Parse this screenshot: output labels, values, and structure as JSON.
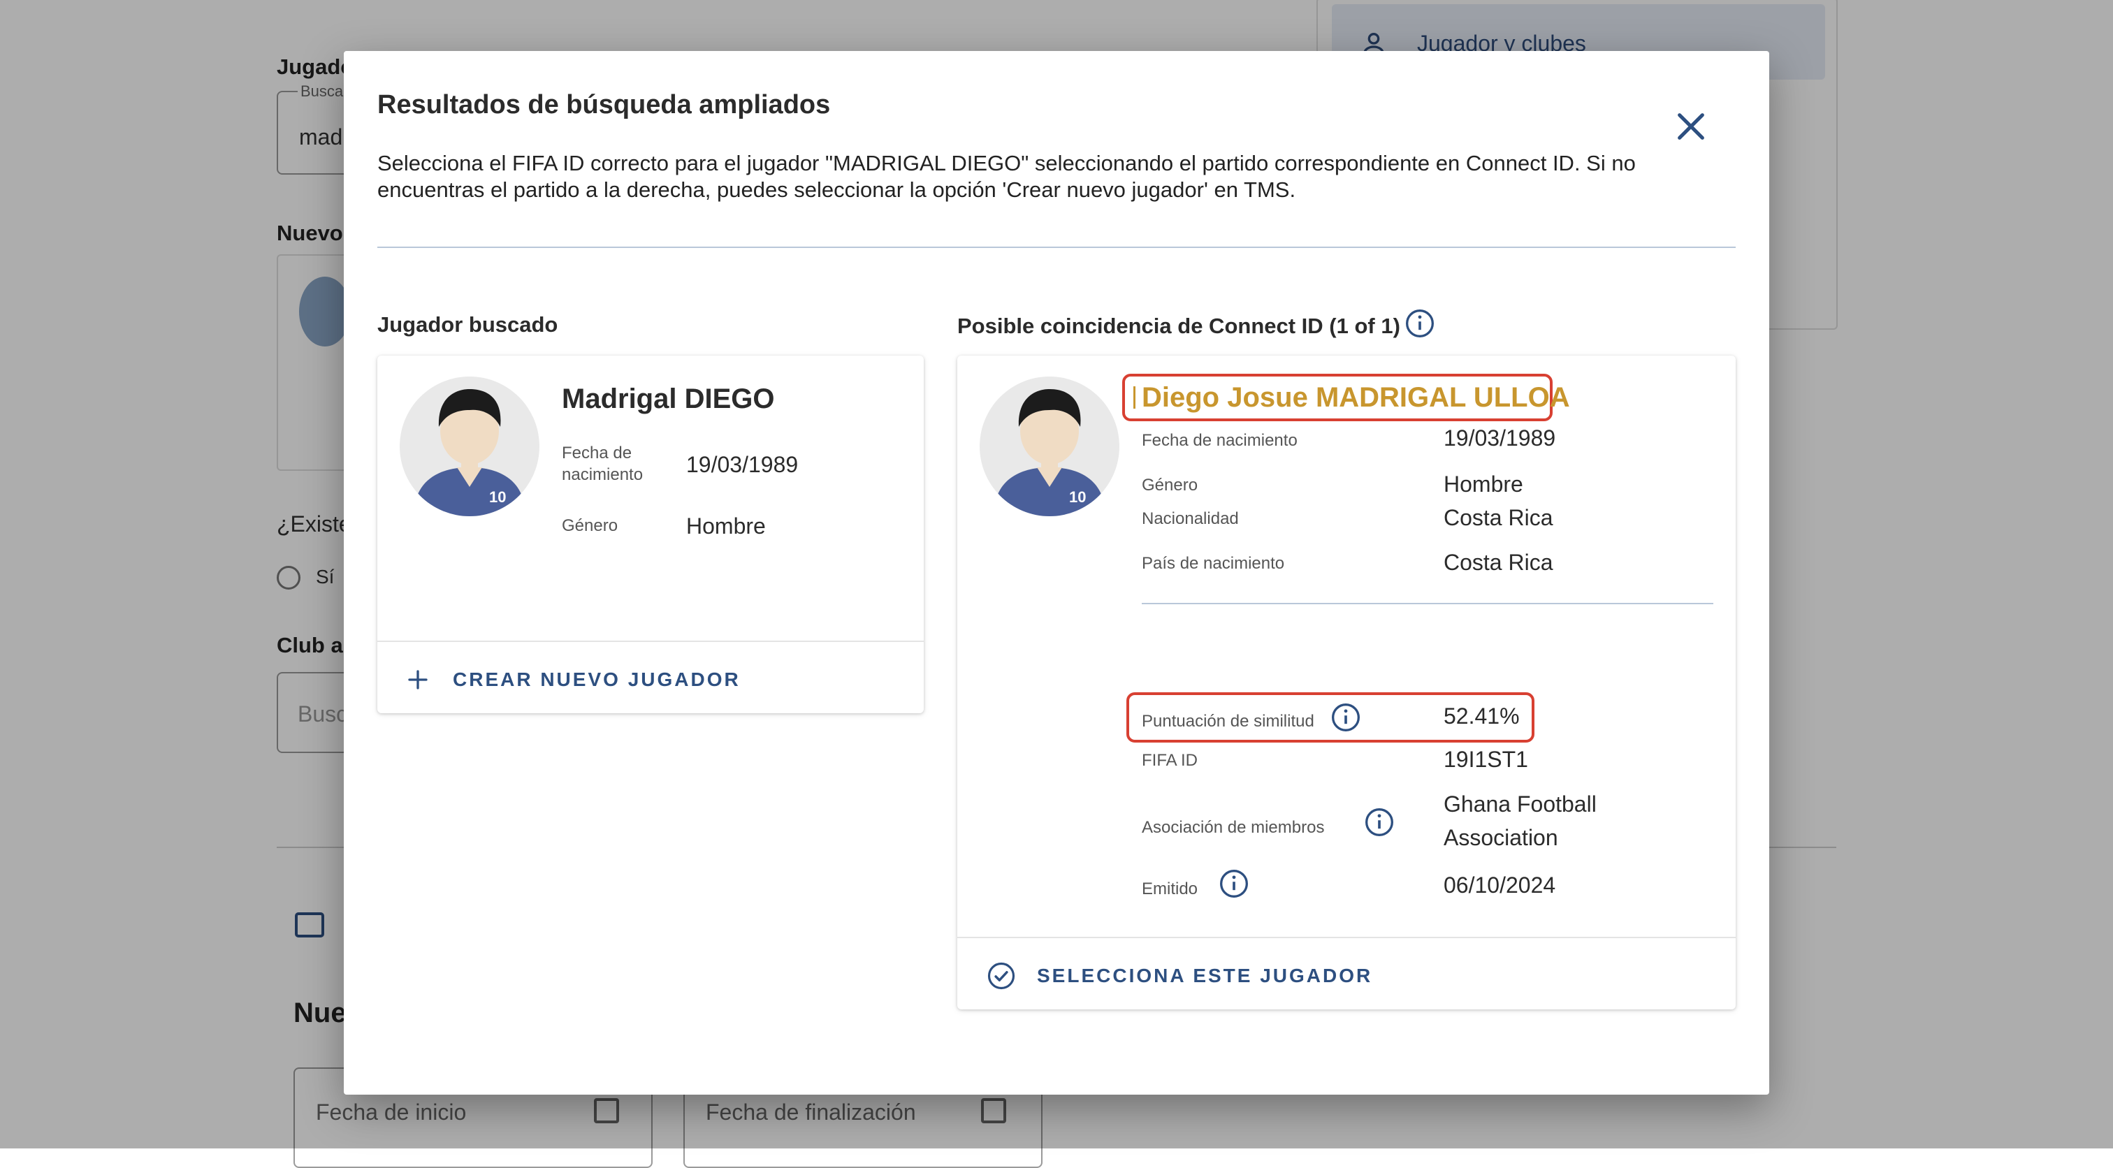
{
  "background": {
    "player_label": "Jugador",
    "search_field_label": "Busca",
    "search_value": "mad",
    "new_label": "Nuevo",
    "exists_question": "¿Existe",
    "radio_yes": "Sí",
    "club_label": "Club a",
    "club_placeholder": "Busc",
    "section_title": "Nue",
    "nav_item": "Jugador y clubes",
    "start_date_placeholder": "Fecha de inicio",
    "end_date_placeholder": "Fecha de finalización"
  },
  "modal": {
    "title": "Resultados de búsqueda ampliados",
    "description": "Selecciona el FIFA ID correcto para el jugador \"MADRIGAL DIEGO\" seleccionando el partido correspondiente en Connect ID. Si no encuentras el partido a la derecha, puedes seleccionar la opción 'Crear nuevo jugador' en TMS.",
    "close_icon": "close-icon"
  },
  "searched": {
    "heading": "Jugador buscado",
    "name": "Madrigal DIEGO",
    "birth_label": "Fecha de nacimiento",
    "birth_value": "19/03/1989",
    "gender_label": "Género",
    "gender_value": "Hombre",
    "jersey_number": "10",
    "action_label": "CREAR NUEVO JUGADOR",
    "action_icon": "plus-icon"
  },
  "match": {
    "heading": "Posible coincidencia de Connect ID (1 of 1)",
    "name": "Diego Josue MADRIGAL ULLOA",
    "name_color": "#c8962e",
    "jersey_number": "10",
    "birth_label": "Fecha de nacimiento",
    "birth_value": "19/03/1989",
    "gender_label": "Género",
    "gender_value": "Hombre",
    "nationality_label": "Nacionalidad",
    "nationality_value": "Costa Rica",
    "birth_country_label": "País de nacimiento",
    "birth_country_value": "Costa Rica",
    "similarity_label": "Puntuación de similitud",
    "similarity_value": "52.41%",
    "fifa_id_label": "FIFA ID",
    "fifa_id_value": "19I1ST1",
    "member_assoc_label": "Asociación de miembros",
    "member_assoc_value": "Ghana Football Association",
    "issued_label": "Emitido",
    "issued_value": "06/10/2024",
    "action_label": "SELECCIONA ESTE JUGADOR",
    "action_icon": "check-circle-icon"
  },
  "colors": {
    "accent": "#2d4f80",
    "highlight": "#d84032"
  }
}
